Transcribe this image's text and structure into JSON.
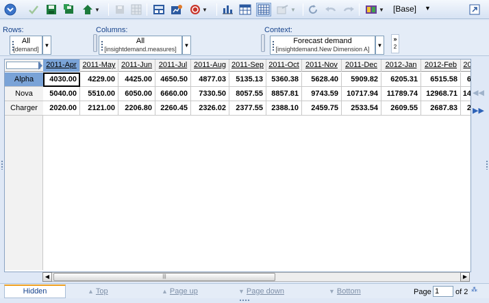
{
  "toolbar": {
    "icons": [
      "collapse-icon",
      "check-icon",
      "save-icon",
      "save-as-icon",
      "home-icon",
      "disk-disabled-icon",
      "grid-disabled-icon",
      "calc-icon",
      "chart-settings-icon",
      "stop-icon",
      "bar-chart-icon",
      "grid-view-icon",
      "table-view-icon",
      "export-icon",
      "refresh-icon",
      "undo-icon",
      "redo-icon",
      "book-icon",
      "maximize-icon"
    ],
    "base_label": "[Base]"
  },
  "filters": {
    "rows": {
      "label": "Rows:",
      "value": "All",
      "sub": "[demand]"
    },
    "columns": {
      "label": "Columns:",
      "value": "All",
      "sub": "[insightdemand.measures]"
    },
    "context": {
      "label": "Context:",
      "value": "Forecast demand",
      "sub": "[insightdemand.New Dimension A]"
    },
    "more": {
      "arrows": "»",
      "count": "2"
    }
  },
  "grid": {
    "columns": [
      "2011-Apr",
      "2011-May",
      "2011-Jun",
      "2011-Jul",
      "2011-Aug",
      "2011-Sep",
      "2011-Oct",
      "2011-Nov",
      "2011-Dec",
      "2012-Jan",
      "2012-Feb",
      "20"
    ],
    "rows": [
      {
        "label": "Alpha",
        "values": [
          "4030.00",
          "4229.00",
          "4425.00",
          "4650.50",
          "4877.03",
          "5135.13",
          "5360.38",
          "5628.40",
          "5909.82",
          "6205.31",
          "6515.58",
          "6"
        ]
      },
      {
        "label": "Nova",
        "values": [
          "5040.00",
          "5510.00",
          "6050.00",
          "6660.00",
          "7330.50",
          "8057.55",
          "8857.81",
          "9743.59",
          "10717.94",
          "11789.74",
          "12968.71",
          "14"
        ]
      },
      {
        "label": "Charger",
        "values": [
          "2020.00",
          "2121.00",
          "2206.80",
          "2260.45",
          "2326.02",
          "2377.55",
          "2388.10",
          "2459.75",
          "2533.54",
          "2609.55",
          "2687.83",
          "2"
        ]
      }
    ]
  },
  "pager": {
    "hidden_tab": "Hidden",
    "top": "Top",
    "page_up": "Page up",
    "page_down": "Page down",
    "bottom": "Bottom",
    "page_label": "Page",
    "page_value": "1",
    "of_label": "of 2"
  }
}
